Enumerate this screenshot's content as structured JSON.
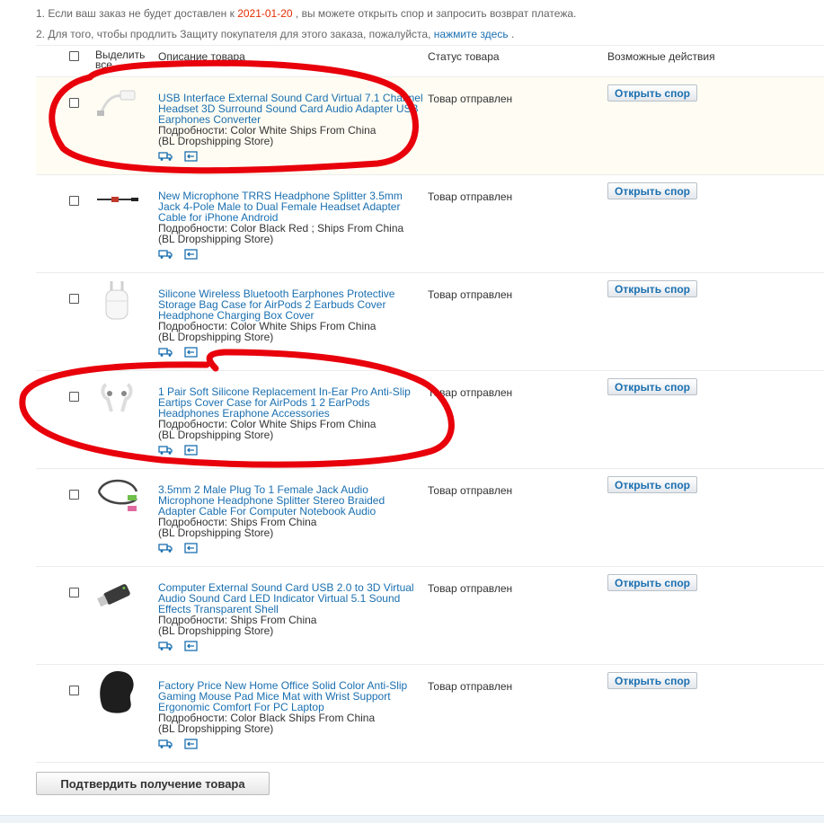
{
  "notices": {
    "line1_prefix": "1. Если ваш заказ не будет доставлен к",
    "line1_date": "2021-01-20",
    "line1_suffix": ", вы можете открыть спор и запросить возврат платежа.",
    "line2_prefix": "2. Для того, чтобы продлить Защиту покупателя для этого заказа, пожалуйста,",
    "line2_link": "нажмите здесь",
    "line2_suffix": "."
  },
  "table": {
    "headers": {
      "select_all": "Выделить все",
      "description": "Описание товара",
      "status": "Статус товара",
      "actions": "Возможные действия"
    },
    "rows": [
      {
        "image": "usb-sound-card-cable-image",
        "title": "USB Interface External Sound Card Virtual 7.1 Channel Headset 3D Surround Sound Card Audio Adapter USB Earphones Converter",
        "details": "Подробности: Color White Ships From China",
        "store": "(BL Dropshipping Store)",
        "status": "Товар отправлен",
        "action": "Открыть спор"
      },
      {
        "image": "headphone-splitter-image",
        "title": "New Microphone TRRS Headphone Splitter 3.5mm Jack 4-Pole Male to Dual Female Headset Adapter Cable for iPhone Android",
        "details": "Подробности: Color Black Red   ; Ships From China",
        "store": "(BL Dropshipping Store)",
        "status": "Товар отправлен",
        "action": "Открыть спор"
      },
      {
        "image": "airpods-case-image",
        "title": "Silicone Wireless Bluetooth Earphones Protective Storage Bag Case for AirPods 2 Earbuds Cover Headphone Charging Box Cover",
        "details": "Подробности: Color White Ships From China",
        "store": "(BL Dropshipping Store)",
        "status": "Товар отправлен",
        "action": "Открыть спор"
      },
      {
        "image": "eartips-image",
        "title": "1 Pair Soft Silicone Replacement In-Ear Pro Anti-Slip Eartips Cover Case for AirPods 1 2 EarPods Headphones Eraphone Accessories",
        "details": "Подробности: Color White Ships From China",
        "store": "(BL Dropshipping Store)",
        "status": "Товар отправлен",
        "action": "Открыть спор"
      },
      {
        "image": "audio-adapter-cable-image",
        "title": "3.5mm 2 Male Plug To 1 Female Jack Audio Microphone Headphone Splitter Stereo Braided Adapter Cable For Computer Notebook Audio",
        "details": "Подробности: Ships From China",
        "store": "(BL Dropshipping Store)",
        "status": "Товар отправлен",
        "action": "Открыть спор"
      },
      {
        "image": "usb-sound-card-stick-image",
        "title": "Computer External Sound Card USB 2.0 to 3D Virtual Audio Sound Card LED Indicator Virtual 5.1 Sound Effects Transparent Shell",
        "details": "Подробности: Ships From China",
        "store": "(BL Dropshipping Store)",
        "status": "Товар отправлен",
        "action": "Открыть спор"
      },
      {
        "image": "mouse-pad-image",
        "title": "Factory Price New Home Office Solid Color Anti-Slip Gaming Mouse Pad Mice Mat with Wrist Support Ergonomic Comfort For PC Laptop",
        "details": "Подробности: Color Black Ships From China",
        "store": "(BL Dropshipping Store)",
        "status": "Товар отправлен",
        "action": "Открыть спор"
      }
    ]
  },
  "confirm_button": "Подтвердить получение товара",
  "icons": [
    "truck-icon",
    "return-icon"
  ],
  "colors": {
    "link": "#1a6fb0",
    "date_highlight": "#e62e04",
    "annotation_marker": "#e8000b",
    "highlight_row_bg": "#fffdf3"
  }
}
